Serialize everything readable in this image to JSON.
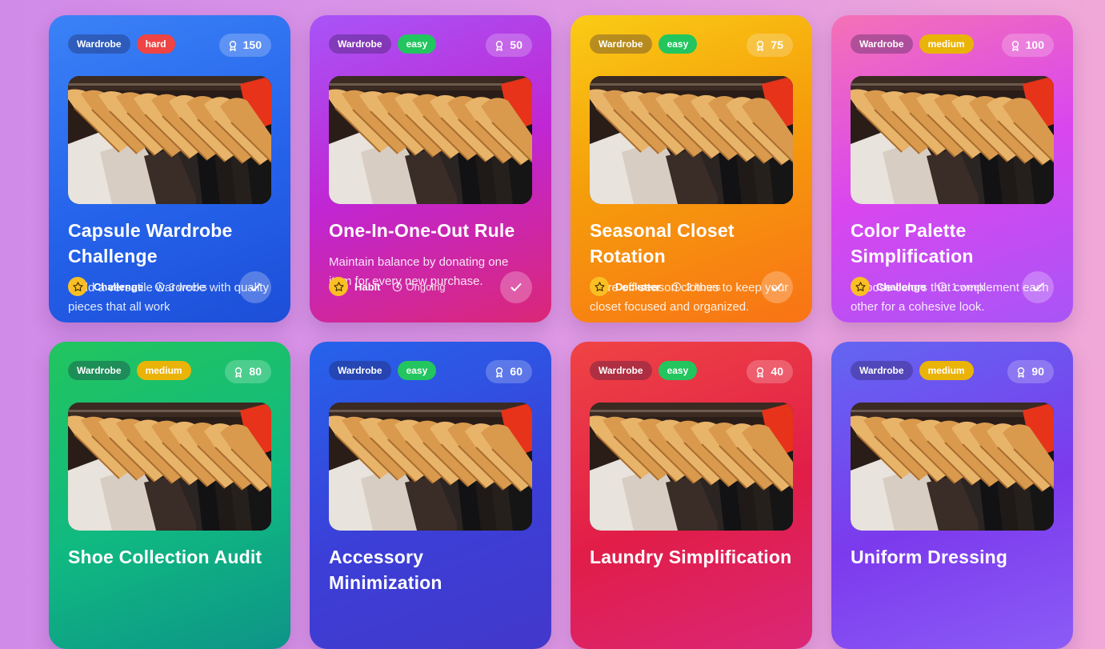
{
  "cards": [
    {
      "title": "Capsule Wardrobe Challenge",
      "category": "Wardrobe",
      "difficulty": "hard",
      "points": "150",
      "description": "Build a versatile wardrobe with quality pieces that all work",
      "type": "Challenge",
      "duration": "3 weeks",
      "bg": "linear-gradient(160deg,#3b82f6 0%,#2563eb 55%,#1d4ed8 100%)",
      "diffColor": "#ef4444"
    },
    {
      "title": "One-In-One-Out Rule",
      "category": "Wardrobe",
      "difficulty": "easy",
      "points": "50",
      "description": "Maintain balance by donating one item for every new purchase.",
      "type": "Habit",
      "duration": "Ongoing",
      "bg": "linear-gradient(160deg,#a855f7 0%,#c026d3 50%,#db2777 100%)",
      "diffColor": "#22c55e"
    },
    {
      "title": "Seasonal Closet Rotation",
      "category": "Wardrobe",
      "difficulty": "easy",
      "points": "75",
      "description": "Store off-season clothes to keep your closet focused and organized.",
      "type": "Declutter",
      "duration": "2 hours",
      "bg": "linear-gradient(160deg,#facc15 0%,#f59e0b 45%,#f97316 100%)",
      "diffColor": "#22c55e"
    },
    {
      "title": "Color Palette Simplification",
      "category": "Wardrobe",
      "difficulty": "medium",
      "points": "100",
      "description": "Choose colors that complement each other for a cohesive look.",
      "type": "Challenge",
      "duration": "1 week",
      "bg": "linear-gradient(160deg,#f472b6 0%,#d946ef 50%,#a855f7 100%)",
      "diffColor": "#eab308"
    },
    {
      "title": "Shoe Collection Audit",
      "category": "Wardrobe",
      "difficulty": "medium",
      "points": "80",
      "description": "",
      "type": "",
      "duration": "",
      "bg": "linear-gradient(160deg,#22c55e 0%,#10b981 55%,#0d9488 100%)",
      "diffColor": "#eab308"
    },
    {
      "title": "Accessory Minimization",
      "category": "Wardrobe",
      "difficulty": "easy",
      "points": "60",
      "description": "",
      "type": "",
      "duration": "",
      "bg": "linear-gradient(160deg,#2563eb 0%,#3b3fd8 55%,#4338ca 100%)",
      "diffColor": "#22c55e"
    },
    {
      "title": "Laundry Simplification",
      "category": "Wardrobe",
      "difficulty": "easy",
      "points": "40",
      "description": "",
      "type": "",
      "duration": "",
      "bg": "linear-gradient(160deg,#ef4444 0%,#e11d48 55%,#db2777 100%)",
      "diffColor": "#22c55e"
    },
    {
      "title": "Uniform Dressing",
      "category": "Wardrobe",
      "difficulty": "medium",
      "points": "90",
      "description": "",
      "type": "",
      "duration": "",
      "bg": "linear-gradient(160deg,#6366f1 0%,#7c3aed 55%,#8b5cf6 100%)",
      "diffColor": "#eab308"
    }
  ]
}
